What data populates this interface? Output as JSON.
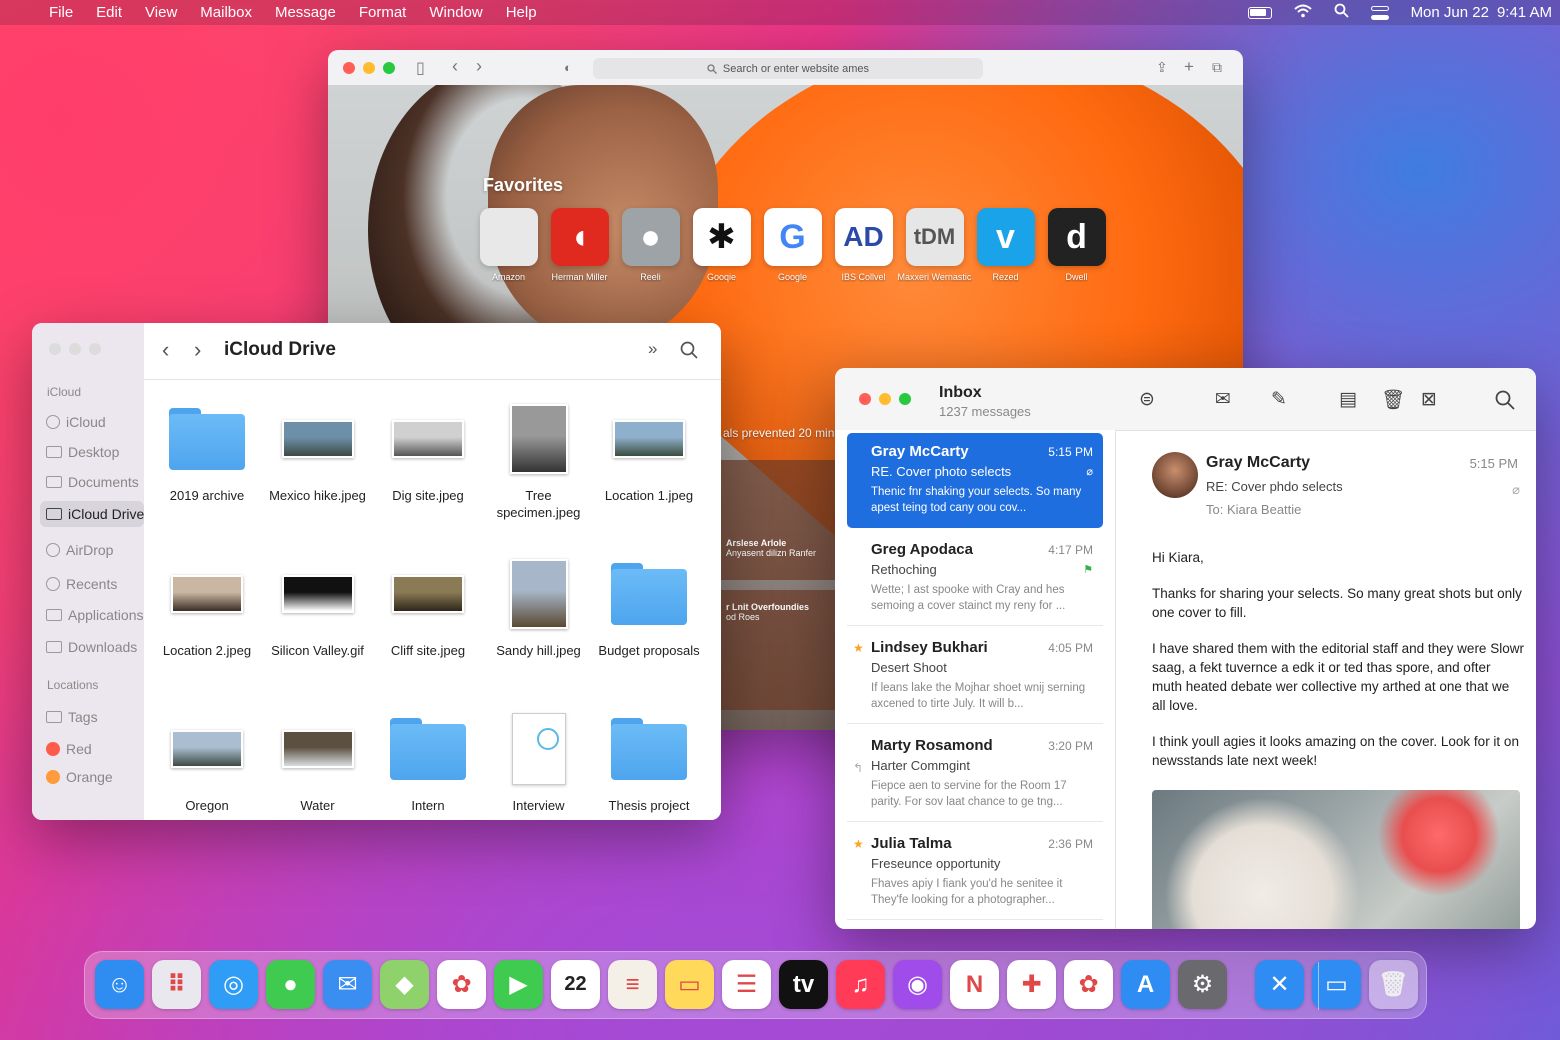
{
  "menubar": {
    "apple_icon": "apple-logo",
    "items": [
      "File",
      "Edit",
      "View",
      "Mailbox",
      "Message",
      "Format",
      "Window",
      "Help"
    ],
    "date": "Mon Jun 22",
    "time": "9:41 AM"
  },
  "safari": {
    "address_placeholder": "Search or enter website ames",
    "favorites_title": "Favorites",
    "favorites": [
      {
        "label": "Amazon",
        "glyph": "",
        "bg": "#e8e8e8",
        "fg": "#777"
      },
      {
        "label": "Herman Miller",
        "glyph": "◖",
        "bg": "#e02a20",
        "fg": "#fff"
      },
      {
        "label": "Reeli",
        "glyph": "●",
        "bg": "#9ea3a7",
        "fg": "#fff"
      },
      {
        "label": "Gooqie",
        "glyph": "✱",
        "bg": "#ffffff",
        "fg": "#111"
      },
      {
        "label": "Google",
        "glyph": "G",
        "bg": "#ffffff",
        "fg": "#4285f4"
      },
      {
        "label": "IBS Collvel",
        "glyph": "AD",
        "bg": "#ffffff",
        "fg": "#2b4aa8"
      },
      {
        "label": "Maxxeri Wernastica",
        "glyph": "tDM",
        "bg": "#e6e6e6",
        "fg": "#555"
      },
      {
        "label": "Rezed",
        "glyph": "v",
        "bg": "#1aa3e8",
        "fg": "#fff"
      },
      {
        "label": "Dwell",
        "glyph": "d",
        "bg": "#222222",
        "fg": "#fff"
      }
    ],
    "privacy_text": "als prevented 20 min",
    "reading": [
      {
        "title": "Arslese Arlole",
        "text": "Anyasent dilizn Ranfer"
      },
      {
        "title": "r Lnit Overfoundies",
        "text": "od Roes"
      }
    ]
  },
  "finder": {
    "title": "iCloud Drive",
    "sections": {
      "icloud": "iCloud",
      "locations": "Locations"
    },
    "sidebar": [
      {
        "label": "iCloud",
        "icon": "cloud-icon"
      },
      {
        "label": "Desktop",
        "icon": "desktop-icon"
      },
      {
        "label": "Documents",
        "icon": "documents-icon"
      },
      {
        "label": "iCloud Drive",
        "icon": "icloud-drive-icon"
      },
      {
        "label": "AirDrop",
        "icon": "airdrop-icon"
      },
      {
        "label": "Recents",
        "icon": "recents-icon"
      },
      {
        "label": "Applications",
        "icon": "applications-icon"
      },
      {
        "label": "Downloads",
        "icon": "downloads-icon"
      },
      {
        "label": "Tags",
        "icon": "tags-icon"
      },
      {
        "label": "Red",
        "icon": "tag-red",
        "color": "#ff5b4a"
      },
      {
        "label": "Orange",
        "icon": "tag-orange",
        "color": "#ff9b3a"
      }
    ],
    "files": [
      {
        "name": "2019 archive",
        "kind": "folder"
      },
      {
        "name": "Mexico hike.jpeg",
        "kind": "photo",
        "c1": "#6e8fa8",
        "c2": "#3d4a45"
      },
      {
        "name": "Dig site.jpeg",
        "kind": "photo",
        "c1": "#d0d0d0",
        "c2": "#555"
      },
      {
        "name": "Tree specimen.jpeg",
        "kind": "photo",
        "c1": "#999",
        "c2": "#333"
      },
      {
        "name": "Location 1.jpeg",
        "kind": "photo",
        "c1": "#8fb0cc",
        "c2": "#3a4d3e"
      },
      {
        "name": "Location 2.jpeg",
        "kind": "photo",
        "c1": "#c9b7a3",
        "c2": "#3b2e26"
      },
      {
        "name": "Silicon Valley.gif",
        "kind": "photo",
        "c1": "#111",
        "c2": "#fff"
      },
      {
        "name": "Cliff site.jpeg",
        "kind": "photo",
        "c1": "#8a7a55",
        "c2": "#2e261a"
      },
      {
        "name": "Sandy hill.jpeg",
        "kind": "photo",
        "c1": "#a7b6c8",
        "c2": "#5b4a34"
      },
      {
        "name": "Budget proposals",
        "kind": "folder"
      },
      {
        "name": "Oregon",
        "kind": "photo",
        "c1": "#a9bed0",
        "c2": "#3f4a45"
      },
      {
        "name": "Water",
        "kind": "photo",
        "c1": "#5c5040",
        "c2": "#d9dde0"
      },
      {
        "name": "Intern",
        "kind": "folder"
      },
      {
        "name": "Interview",
        "kind": "doc"
      },
      {
        "name": "Thesis project",
        "kind": "folder"
      }
    ]
  },
  "mail": {
    "mailbox": "Inbox",
    "count": "1237 messages",
    "messages": [
      {
        "from": "Gray McCarty",
        "time": "5:15 PM",
        "subject": "RE. Cover photo selects",
        "preview": "Thenic fnr shaking your selects. So many apest teing tod cany oou cov...",
        "selected": true,
        "mark": "attach"
      },
      {
        "from": "Greg Apodaca",
        "time": "4:17 PM",
        "subject": "Rethoching",
        "preview": "Wette; I ast spooke with Cray and hes semoing a cover stainct my reny for ...",
        "mark": "flag"
      },
      {
        "from": "Lindsey Bukhari",
        "time": "4:05 PM",
        "subject": "Desert Shoot",
        "preview": "If leans lake the Mojhar shoet wnij serning axcened to tirte July. It will b...",
        "mark": "star"
      },
      {
        "from": "Marty Rosamond",
        "time": "3:20 PM",
        "subject": "Harter Commgint",
        "preview": "Fiepce aen to servine for the Room 17 parity. For sov laat chance to ge tng...",
        "mark": "reply"
      },
      {
        "from": "Julia Talma",
        "time": "2:36 PM",
        "subject": "Freseunce opportunity",
        "preview": "Fhaves apiy I fiank you'd he senitee it They'fe looking for a photographer...",
        "mark": "star"
      }
    ],
    "reader": {
      "from": "Gray McCarty",
      "subject": "RE: Cover phdo selects",
      "to_label": "To:",
      "to": "Kiara Beattie",
      "time": "5:15 PM",
      "body": [
        "Hi Kiara,",
        "Thanks for sharing your selects. So many great shots but only one cover to fill.",
        "I have shared them with the editorial staff and they were Slowr saag, a fekt tuvernce a edk it or ted thas spore, and ofter muth heated debate wer collective my arthed at one that we all love.",
        "I think youll agies it looks amazing on the cover. Look for it on newsstands late next week!"
      ]
    }
  },
  "dock": {
    "apps": [
      {
        "name": "finder",
        "glyph": "☺",
        "bg": "#2f8cf0"
      },
      {
        "name": "launchpad",
        "glyph": "⠿",
        "bg": "#e8e8ee"
      },
      {
        "name": "safari",
        "glyph": "◎",
        "bg": "#2f9cf5"
      },
      {
        "name": "messages",
        "glyph": "●",
        "bg": "#3ecb4f"
      },
      {
        "name": "mail",
        "glyph": "✉",
        "bg": "#3a8ef2"
      },
      {
        "name": "maps",
        "glyph": "◆",
        "bg": "#8fd16b"
      },
      {
        "name": "photos",
        "glyph": "✿",
        "bg": "#ffffff"
      },
      {
        "name": "facetime",
        "glyph": "▶",
        "bg": "#3ecb4f"
      },
      {
        "name": "calendar",
        "glyph": "22",
        "bg": "#ffffff"
      },
      {
        "name": "contacts",
        "glyph": "≡",
        "bg": "#f4f0e8"
      },
      {
        "name": "notes",
        "glyph": "▭",
        "bg": "#ffd95a"
      },
      {
        "name": "reminders",
        "glyph": "☰",
        "bg": "#ffffff"
      },
      {
        "name": "tv",
        "glyph": "tv",
        "bg": "#111111"
      },
      {
        "name": "music",
        "glyph": "♫",
        "bg": "#ff3b58"
      },
      {
        "name": "podcasts",
        "glyph": "◉",
        "bg": "#a04cea"
      },
      {
        "name": "news",
        "glyph": "N",
        "bg": "#ffffff"
      },
      {
        "name": "numbers",
        "glyph": "✚",
        "bg": "#ffffff"
      },
      {
        "name": "photos-2",
        "glyph": "✿",
        "bg": "#ffffff"
      },
      {
        "name": "app-store",
        "glyph": "A",
        "bg": "#2e8cf2"
      },
      {
        "name": "system-preferences",
        "glyph": "⚙",
        "bg": "#6a6a6e"
      },
      {
        "name": "mail-2",
        "glyph": "✕",
        "bg": "#2e8cf2"
      },
      {
        "name": "screen",
        "glyph": "▭",
        "bg": "#2e8cf2"
      },
      {
        "name": "trash",
        "glyph": "🗑",
        "bg": "rgba(255,255,255,0.4)"
      }
    ]
  }
}
